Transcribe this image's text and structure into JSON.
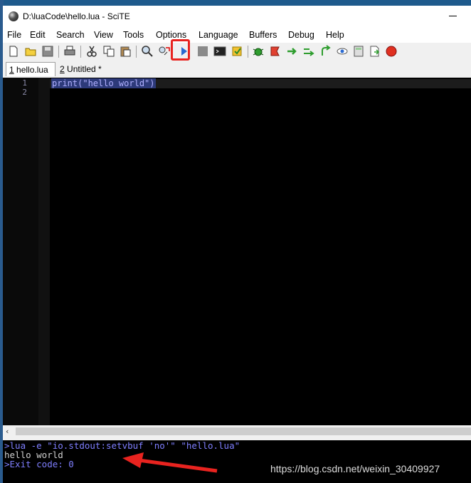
{
  "window": {
    "title": "D:\\luaCode\\hello.lua - SciTE"
  },
  "menu": [
    "File",
    "Edit",
    "Search",
    "View",
    "Tools",
    "Options",
    "Language",
    "Buffers",
    "Debug",
    "Help"
  ],
  "tabs": [
    {
      "num": "1",
      "label": " hello.lua"
    },
    {
      "num": "2",
      "label": " Untitled *"
    }
  ],
  "editor": {
    "line_numbers": [
      "1",
      "2"
    ],
    "code": "print(\"hello world\")"
  },
  "output": {
    "lines": [
      {
        "text": ">lua -e \"io.stdout:setvbuf 'no'\" \"hello.lua\"",
        "color": "#7f7fff"
      },
      {
        "text": "hello world",
        "color": "#d0d0d0"
      },
      {
        "text": ">Exit code: 0",
        "color": "#7f7fff"
      }
    ]
  },
  "watermark": "https://blog.csdn.net/weixin_30409927",
  "colors": {
    "highlight": "#e8231f",
    "editor_bg": "#000000"
  }
}
